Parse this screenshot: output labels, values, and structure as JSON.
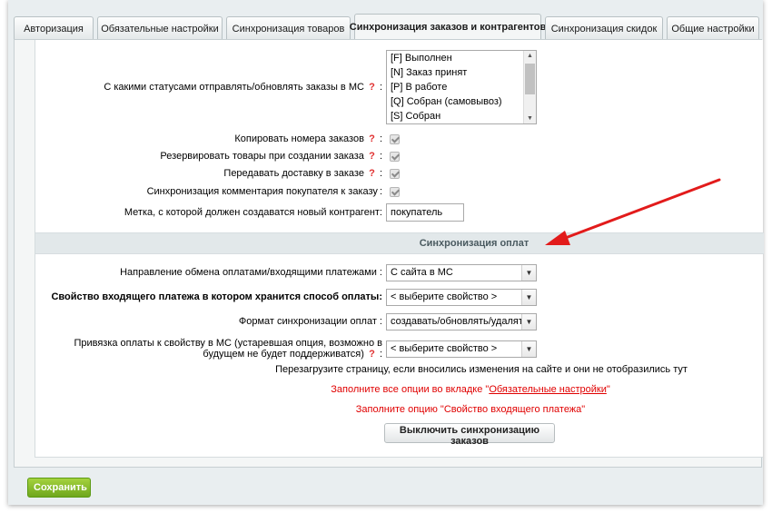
{
  "tabs": [
    {
      "label": "Авторизация"
    },
    {
      "label": "Обязательные настройки"
    },
    {
      "label": "Синхронизация товаров"
    },
    {
      "label": "Синхронизация заказов и контрагентов"
    },
    {
      "label": "Синхронизация скидок"
    },
    {
      "label": "Общие настройки"
    }
  ],
  "top_strip": "",
  "orders": {
    "statuses_label": "С какими статусами отправлять/обновлять заказы в МС",
    "statuses": [
      "[F] Выполнен",
      "[N] Заказ принят",
      "[P] В работе",
      "[Q] Собран (самовывоз)",
      "[S] Собран"
    ],
    "copy_numbers_label": "Копировать номера заказов",
    "reserve_label": "Резервировать товары при создании заказа",
    "delivery_label": "Передавать доставку в заказе",
    "comment_label": "Синхронизация комментария покупателя к заказу",
    "tag_label": "Метка, с которой должен создаватся новый контрагент:",
    "tag_value": "покупатель",
    "help_glyph": "?",
    "colon": ":"
  },
  "payments": {
    "section_title": "Синхронизация оплат",
    "direction_label": "Направление обмена оплатами/входящими платежами :",
    "direction_value": "С сайта в МС",
    "property_label": "Свойство входящего платежа в котором хранится способ оплаты:",
    "property_value": "< выберите свойство >",
    "format_label": "Формат синхронизации оплат :",
    "format_value": "создавать/обновлять/удалять",
    "binding_label": "Привязка оплаты к свойству в МС (устаревшая опция, возможно в будущем не будет поддерживатся)",
    "binding_value": "< выберите свойство >"
  },
  "notes": {
    "reload": "Перезагрузите страницу, если вносились изменения на сайте и они не отобразились тут",
    "fill_all_prefix": "Заполните все опции во вкладке \"",
    "fill_all_link": "Обязательные настройки",
    "fill_all_suffix": "\"",
    "fill_option": "Заполните опцию \"Свойство входящего платежа\""
  },
  "buttons": {
    "disable_sync": "Выключить синхронизацию заказов",
    "save": "Сохранить"
  },
  "colors": {
    "arrow": "#e21b1b",
    "save_bg": "#86bb2a",
    "error_text": "#e00000",
    "help_mark": "#e03030"
  }
}
